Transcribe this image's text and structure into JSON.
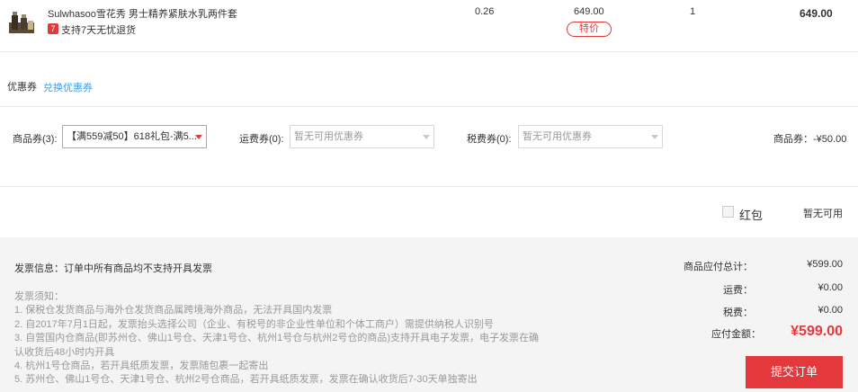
{
  "product": {
    "name": "Sulwhasoo雪花秀 男士精养紧肤水乳两件套",
    "badge": "7",
    "return_policy": "支持7天无忧退货",
    "weight": "0.26",
    "price": "649.00",
    "tag": "特价",
    "quantity": "1",
    "subtotal": "649.00"
  },
  "coupons": {
    "title": "优惠券",
    "exchange_link": "兑换优惠券",
    "goods_label": "商品券(3):",
    "goods_selected": "【满559减50】618礼包-满5...",
    "shipping_label": "运费券(0):",
    "shipping_selected": "暂无可用优惠券",
    "tax_label": "税费券(0):",
    "tax_selected": "暂无可用优惠券",
    "goods_discount": "商品券：-¥50.00"
  },
  "redpack": {
    "label": "红包",
    "status": "暂无可用"
  },
  "invoice": {
    "title": "发票信息：订单中所有商品均不支持开具发票",
    "notice_lines": [
      "发票须知：",
      "1. 保税仓发货商品与海外仓发货商品属跨境海外商品，无法开具国内发票",
      "2. 自2017年7月1日起，发票抬头选择公司（企业、有税号的非企业性单位和个体工商户）需提供纳税人识别号",
      "3. 自营国内仓商品(即苏州仓、佛山1号仓、天津1号仓、杭州1号仓与杭州2号仓的商品)支持开具电子发票，电子发票在确",
      "认收货后48小时内开具",
      "4. 杭州1号仓商品，若开具纸质发票，发票随包裹一起寄出",
      "5. 苏州仓、佛山1号仓、天津1号仓、杭州2号仓商品，若开具纸质发票，发票在确认收货后7-30天单独寄出"
    ]
  },
  "summary": {
    "goods_total_label": "商品应付总计：",
    "goods_total": "¥599.00",
    "shipping_label": "运费：",
    "shipping": "¥0.00",
    "tax_label": "税费：",
    "tax": "¥0.00",
    "payable_label": "应付金额：",
    "payable": "¥599.00",
    "submit": "提交订单"
  }
}
